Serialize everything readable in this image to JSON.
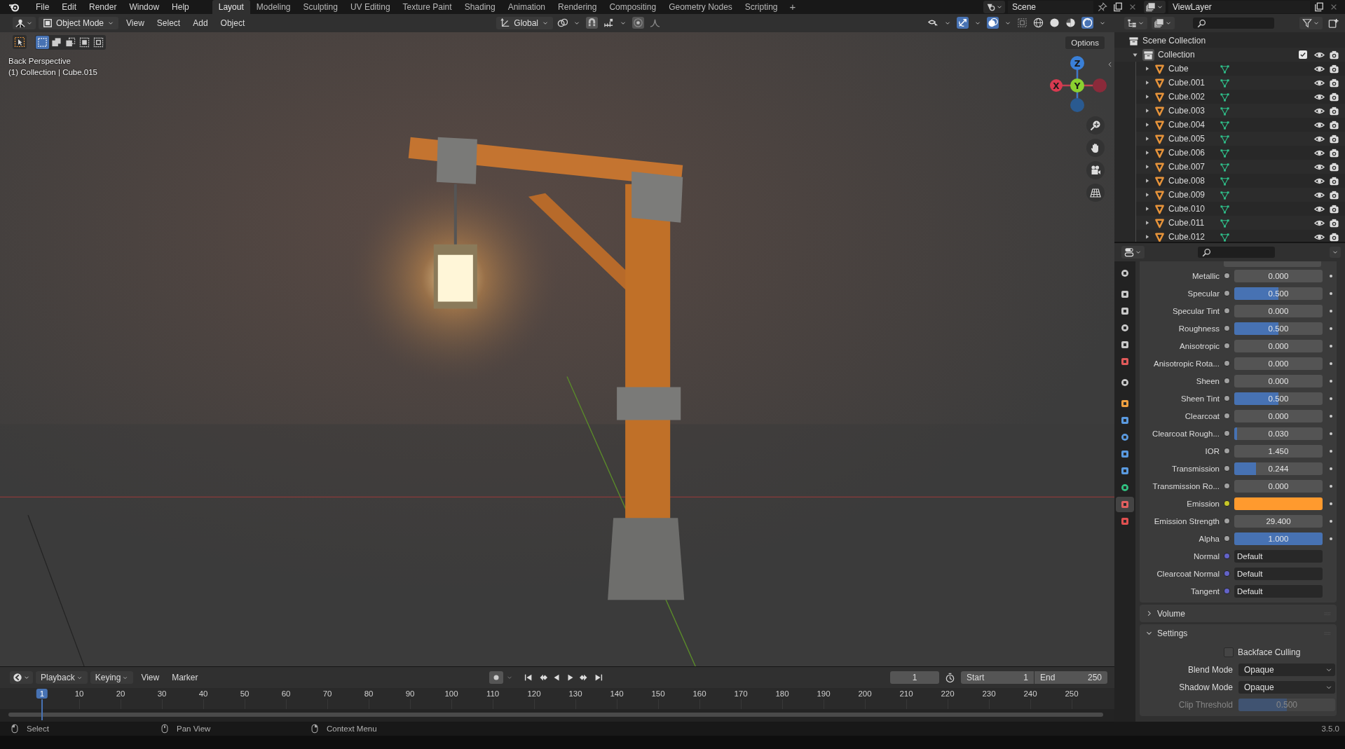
{
  "menu": [
    "File",
    "Edit",
    "Render",
    "Window",
    "Help"
  ],
  "workspaces": [
    {
      "label": "Layout",
      "selected": true
    },
    {
      "label": "Modeling",
      "selected": false
    },
    {
      "label": "Sculpting",
      "selected": false
    },
    {
      "label": "UV Editing",
      "selected": false
    },
    {
      "label": "Texture Paint",
      "selected": false
    },
    {
      "label": "Shading",
      "selected": false
    },
    {
      "label": "Animation",
      "selected": false
    },
    {
      "label": "Rendering",
      "selected": false
    },
    {
      "label": "Compositing",
      "selected": false
    },
    {
      "label": "Geometry Nodes",
      "selected": false
    },
    {
      "label": "Scripting",
      "selected": false
    }
  ],
  "add_workspace": "+",
  "scene": "Scene",
  "view_layer": "ViewLayer",
  "viewport_header": {
    "mode": "Object Mode",
    "menus": [
      "View",
      "Select",
      "Add",
      "Object"
    ],
    "orientation": "Global",
    "options": "Options"
  },
  "viewport": {
    "view_name": "Back Perspective",
    "object_info": "(1) Collection | Cube.015",
    "axes": [
      "Z",
      "X",
      "Y"
    ]
  },
  "outliner": {
    "root": "Scene Collection",
    "collection": {
      "name": "Collection",
      "expanded": true,
      "checked": true,
      "children": [
        {
          "name": "Cube"
        },
        {
          "name": "Cube.001"
        },
        {
          "name": "Cube.002"
        },
        {
          "name": "Cube.003"
        },
        {
          "name": "Cube.004"
        },
        {
          "name": "Cube.005"
        },
        {
          "name": "Cube.006"
        },
        {
          "name": "Cube.007"
        },
        {
          "name": "Cube.008"
        },
        {
          "name": "Cube.009"
        },
        {
          "name": "Cube.010"
        },
        {
          "name": "Cube.011"
        },
        {
          "name": "Cube.012"
        }
      ]
    }
  },
  "properties": {
    "tabs": [
      {
        "color": "#c8c8c8",
        "selected": false
      },
      {
        "color": "#c8c8c8",
        "selected": false
      },
      {
        "color": "#c8c8c8",
        "selected": false
      },
      {
        "color": "#c8c8c8",
        "selected": false
      },
      {
        "color": "#c8c8c8",
        "selected": false
      },
      {
        "color": "#e05a5a",
        "selected": false
      },
      {
        "color": "#c8c8c8",
        "selected": false
      },
      {
        "color": "#f0a040",
        "selected": false
      },
      {
        "color": "#5a9ae0",
        "selected": false
      },
      {
        "color": "#5a9ae0",
        "selected": false
      },
      {
        "color": "#5a9ae0",
        "selected": false
      },
      {
        "color": "#5a9ae0",
        "selected": false
      },
      {
        "color": "#30c080",
        "selected": false
      },
      {
        "color": "#e06060",
        "selected": true
      },
      {
        "color": "#e05050",
        "selected": false
      }
    ],
    "rows": [
      {
        "label": "Metallic",
        "kind": "slider",
        "value": "0.000",
        "level": 0
      },
      {
        "label": "Specular",
        "kind": "slider",
        "value": "0.500",
        "level": 0.5
      },
      {
        "label": "Specular Tint",
        "kind": "slider",
        "value": "0.000",
        "level": 0
      },
      {
        "label": "Roughness",
        "kind": "slider",
        "value": "0.500",
        "level": 0.5
      },
      {
        "label": "Anisotropic",
        "kind": "slider",
        "value": "0.000",
        "level": 0
      },
      {
        "label": "Anisotropic Rota...",
        "kind": "slider",
        "value": "0.000",
        "level": 0
      },
      {
        "label": "Sheen",
        "kind": "slider",
        "value": "0.000",
        "level": 0
      },
      {
        "label": "Sheen Tint",
        "kind": "slider",
        "value": "0.500",
        "level": 0.5
      },
      {
        "label": "Clearcoat",
        "kind": "slider",
        "value": "0.000",
        "level": 0
      },
      {
        "label": "Clearcoat Rough...",
        "kind": "slider",
        "value": "0.030",
        "level": 0.03
      },
      {
        "label": "IOR",
        "kind": "number",
        "value": "1.450"
      },
      {
        "label": "Transmission",
        "kind": "slider",
        "value": "0.244",
        "level": 0.244
      },
      {
        "label": "Transmission Ro...",
        "kind": "slider",
        "value": "0.000",
        "level": 0
      },
      {
        "label": "Emission",
        "kind": "color",
        "color": "#ff9a2e"
      },
      {
        "label": "Emission Strength",
        "kind": "number",
        "value": "29.400"
      },
      {
        "label": "Alpha",
        "kind": "slider",
        "value": "1.000",
        "level": 1
      },
      {
        "label": "Normal",
        "kind": "link",
        "value": "Default"
      },
      {
        "label": "Clearcoat Normal",
        "kind": "link",
        "value": "Default"
      },
      {
        "label": "Tangent",
        "kind": "link",
        "value": "Default"
      }
    ],
    "panels": [
      {
        "label": "Volume",
        "expanded": false
      },
      {
        "label": "Settings",
        "expanded": true
      }
    ],
    "settings": {
      "backface_culling": {
        "label": "Backface Culling",
        "checked": false
      },
      "dropdowns": [
        {
          "label": "Blend Mode",
          "value": "Opaque"
        },
        {
          "label": "Shadow Mode",
          "value": "Opaque"
        }
      ],
      "clip_threshold": {
        "label": "Clip Threshold",
        "value": "0.500",
        "level": 0.5,
        "disabled": true
      }
    }
  },
  "timeline": {
    "menus": [
      "Playback",
      "Keying",
      "View",
      "Marker"
    ],
    "current_frame": "1",
    "start_label": "Start",
    "start": "1",
    "end_label": "End",
    "end": "250",
    "playhead": "1",
    "ticks": [
      "10",
      "20",
      "30",
      "40",
      "50",
      "60",
      "70",
      "80",
      "90",
      "100",
      "110",
      "120",
      "130",
      "140",
      "150",
      "160",
      "170",
      "180",
      "190",
      "200",
      "210",
      "220",
      "230",
      "240",
      "250"
    ]
  },
  "status_bar": {
    "items": [
      "Select",
      "Pan View",
      "Context Menu"
    ],
    "version": "3.5.0"
  }
}
